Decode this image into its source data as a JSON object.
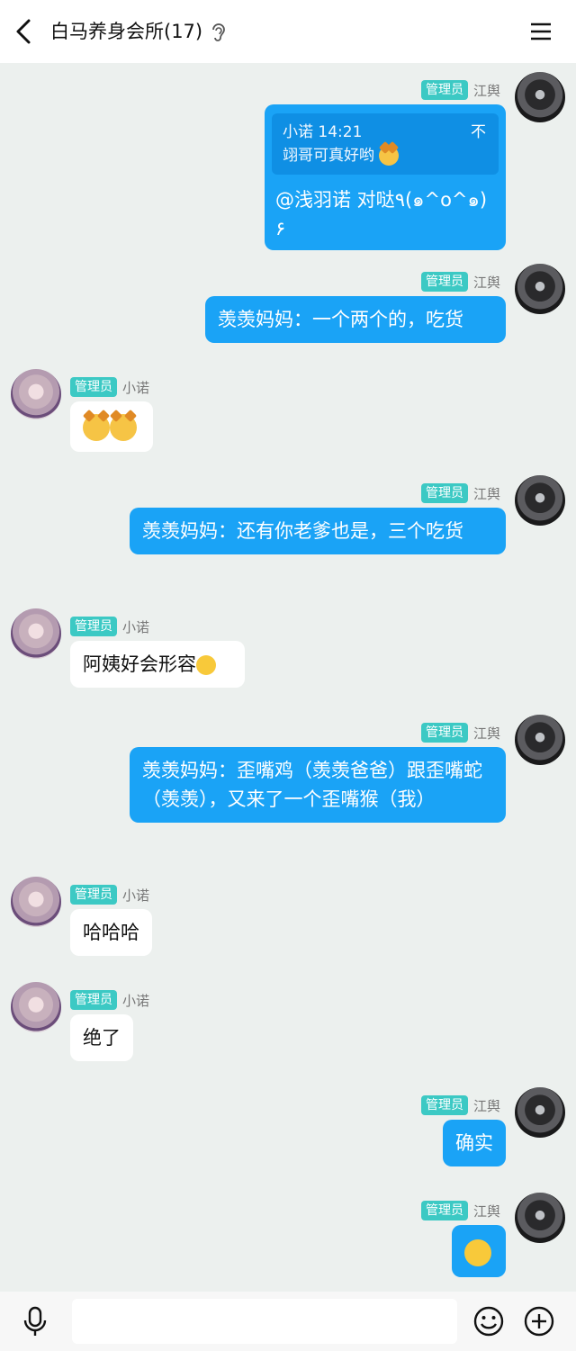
{
  "header": {
    "title": "白马养身会所(17)"
  },
  "messages": [
    {
      "side": "right",
      "role": "管理员",
      "sender": "江舆",
      "quote": {
        "meta": "小诺 14:21",
        "close": "不",
        "text": "翊哥可真好哟"
      },
      "text": "@浅羽诺 对哒٩(๑^o^๑)۶"
    },
    {
      "side": "right",
      "role": "管理员",
      "sender": "江舆",
      "text": "羡羡妈妈：一个两个的，吃货"
    },
    {
      "side": "left",
      "role": "管理员",
      "sender": "小诺",
      "text": ""
    },
    {
      "side": "right",
      "role": "管理员",
      "sender": "江舆",
      "text": "羡羡妈妈：还有你老爹也是，三个吃货"
    },
    {
      "side": "left",
      "role": "管理员",
      "sender": "小诺",
      "text": "阿姨好会形容"
    },
    {
      "side": "right",
      "role": "管理员",
      "sender": "江舆",
      "text": "羡羡妈妈：歪嘴鸡（羡羡爸爸）跟歪嘴蛇（羡羡），又来了一个歪嘴猴（我）"
    },
    {
      "side": "left",
      "role": "管理员",
      "sender": "小诺",
      "text": "哈哈哈"
    },
    {
      "side": "left",
      "role": "管理员",
      "sender": "小诺",
      "text": "绝了"
    },
    {
      "side": "right",
      "role": "管理员",
      "sender": "江舆",
      "text": "确实"
    },
    {
      "side": "right",
      "role": "管理员",
      "sender": "江舆",
      "text": ""
    }
  ],
  "icons": {
    "back": "back-arrow-icon",
    "ear": "ear-icon",
    "menu": "menu-icon",
    "mic": "microphone-icon",
    "emoji": "smiley-icon",
    "plus": "plus-icon"
  },
  "colors": {
    "accent": "#1aa3f6",
    "badge": "#3cc9c4",
    "background": "#ecf0ee"
  }
}
